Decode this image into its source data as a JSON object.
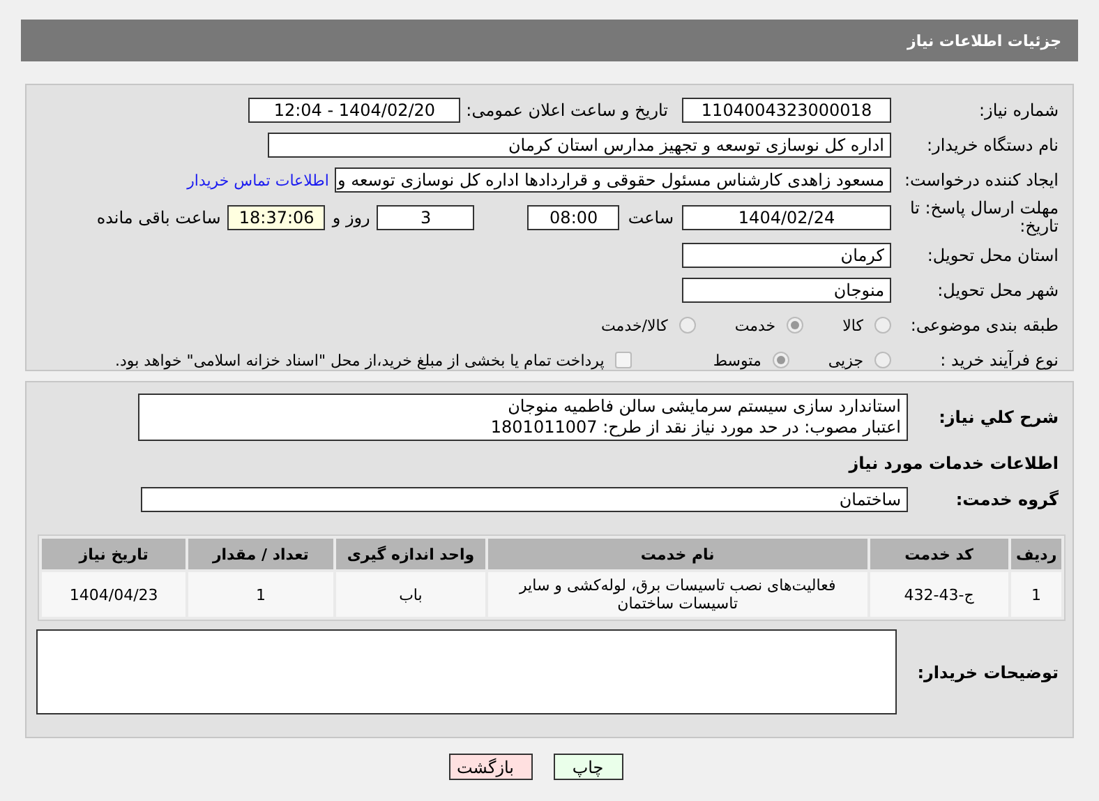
{
  "header": {
    "title": "جزئیات اطلاعات نیاز"
  },
  "need_number": {
    "label": "شماره نیاز:",
    "value": "1104004323000018"
  },
  "announce": {
    "label": "تاریخ و ساعت اعلان عمومی:",
    "value": "1404/02/20 - 12:04"
  },
  "buyer": {
    "label": "نام دستگاه خریدار:",
    "value": "اداره کل نوسازی  توسعه و تجهیز مدارس استان کرمان"
  },
  "requester": {
    "label": "ایجاد کننده درخواست:",
    "value": "مسعود زاهدی کارشناس مسئول حقوقی و قراردادها اداره کل نوسازی  توسعه و",
    "link": "اطلاعات تماس خریدار"
  },
  "deadline": {
    "label": "مهلت ارسال پاسخ: تا تاریخ:",
    "date": "1404/02/24",
    "time_label": "ساعت",
    "time": "08:00",
    "days": "3",
    "days_label": "روز و",
    "remaining": "18:37:06",
    "remaining_label": "ساعت باقی مانده"
  },
  "province": {
    "label": "استان محل تحویل:",
    "value": "کرمان"
  },
  "city": {
    "label": "شهر محل تحویل:",
    "value": "منوجان"
  },
  "category": {
    "label": "طبقه بندی موضوعی:",
    "options": [
      {
        "label": "کالا",
        "selected": false
      },
      {
        "label": "خدمت",
        "selected": true
      },
      {
        "label": "کالا/خدمت",
        "selected": false
      }
    ]
  },
  "process": {
    "label": "نوع فرآیند خرید :",
    "options": [
      {
        "label": "جزیی",
        "selected": false
      },
      {
        "label": "متوسط",
        "selected": true
      }
    ],
    "payment": {
      "label": "پرداخت تمام یا بخشی از مبلغ خرید،از محل \"اسناد خزانه اسلامی\" خواهد بود.",
      "checked": false
    }
  },
  "description": {
    "label": "شرح کلي نیاز:",
    "lines": [
      "استاندارد سازی سیستم سرمایشی سالن فاطمیه منوجان",
      "اعتبار مصوب: در حد مورد نیاز نقد   از طرح: 1801011007"
    ]
  },
  "services_title": "اطلاعات خدمات مورد نیاز",
  "service_group": {
    "label": "گروه خدمت:",
    "value": "ساختمان"
  },
  "table": {
    "columns": [
      "ردیف",
      "کد خدمت",
      "نام خدمت",
      "واحد اندازه گیری",
      "تعداد / مقدار",
      "تاریخ نیاز"
    ],
    "rows": [
      [
        "1",
        "ج-43-432",
        "فعالیت‌های نصب تاسیسات برق، لوله‌کشی و سایر تاسیسات ساختمان",
        "باب",
        "1",
        "1404/04/23"
      ]
    ]
  },
  "buyer_notes": {
    "label": "توضیحات خریدار:"
  },
  "buttons": [
    {
      "label": "چاپ",
      "kind": "print"
    },
    {
      "label": "بازگشت",
      "kind": "back"
    }
  ]
}
